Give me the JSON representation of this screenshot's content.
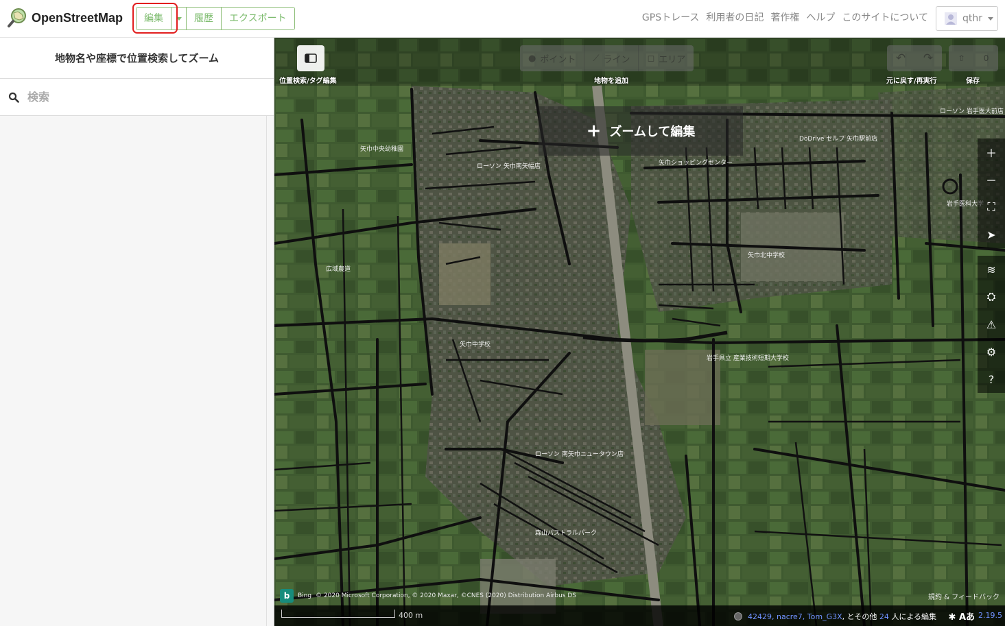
{
  "header": {
    "logo_text": "OpenStreetMap",
    "edit_label": "編集",
    "history_label": "履歴",
    "export_label": "エクスポート",
    "nav": [
      "GPSトレース",
      "利用者の日記",
      "著作権",
      "ヘルプ",
      "このサイトについて"
    ],
    "user_name": "qthr"
  },
  "sidebar": {
    "title": "地物名や座標で位置検索してズーム",
    "search_placeholder": "検索"
  },
  "map": {
    "sidebar_toggle_label": "位置検索/タグ編集",
    "modes": [
      "ポイント",
      "ライン",
      "エリア"
    ],
    "add_feature_label": "地物を追加",
    "undo_redo_label": "元に戻す/再実行",
    "save_label": "保存",
    "save_count": "0",
    "zoom_to_edit": "ズームして編集",
    "attribution_bing": "Bing",
    "attribution_text": "© 2020 Microsoft Corporation, © 2020 Maxar, ©CNES (2020) Distribution Airbus DS",
    "terms": "規約 & フィードバック",
    "scale": "400 m",
    "contributors_links": "42429, nacre7, Tom_G3X",
    "contributors_sep": ",",
    "contributors_mid": "とその他",
    "contributors_count": "24",
    "contributors_suffix": "人による編集",
    "lang_icon": "Aあ",
    "version": "2.19.5",
    "map_labels": [
      "矢巾中央幼稚園",
      "ローソン 矢巾南矢幅店",
      "矢巾ショッピングセンター",
      "DoDrive セルフ 矢巾駅前店",
      "ローソン 岩手医大前店",
      "岩手医科大学",
      "矢巾北中学校",
      "矢巾中学校",
      "岩手県立 産業技術短期大学校",
      "ローソン 南矢巾ニュータウン店",
      "森山パストラルパーク",
      "広域農道"
    ]
  },
  "colors": {
    "accent": "#7ebc6f",
    "highlight": "#e21e1e",
    "link": "#7092ff"
  },
  "icons": [
    "search-icon",
    "sidebar-icon",
    "point-icon",
    "line-icon",
    "area-icon",
    "undo-icon",
    "redo-icon",
    "upload-icon",
    "zoom-in-icon",
    "zoom-out-icon",
    "zoom-selection-icon",
    "geolocate-icon",
    "layers-icon",
    "map-data-icon",
    "issues-icon",
    "preferences-icon",
    "help-icon",
    "bug-icon"
  ]
}
